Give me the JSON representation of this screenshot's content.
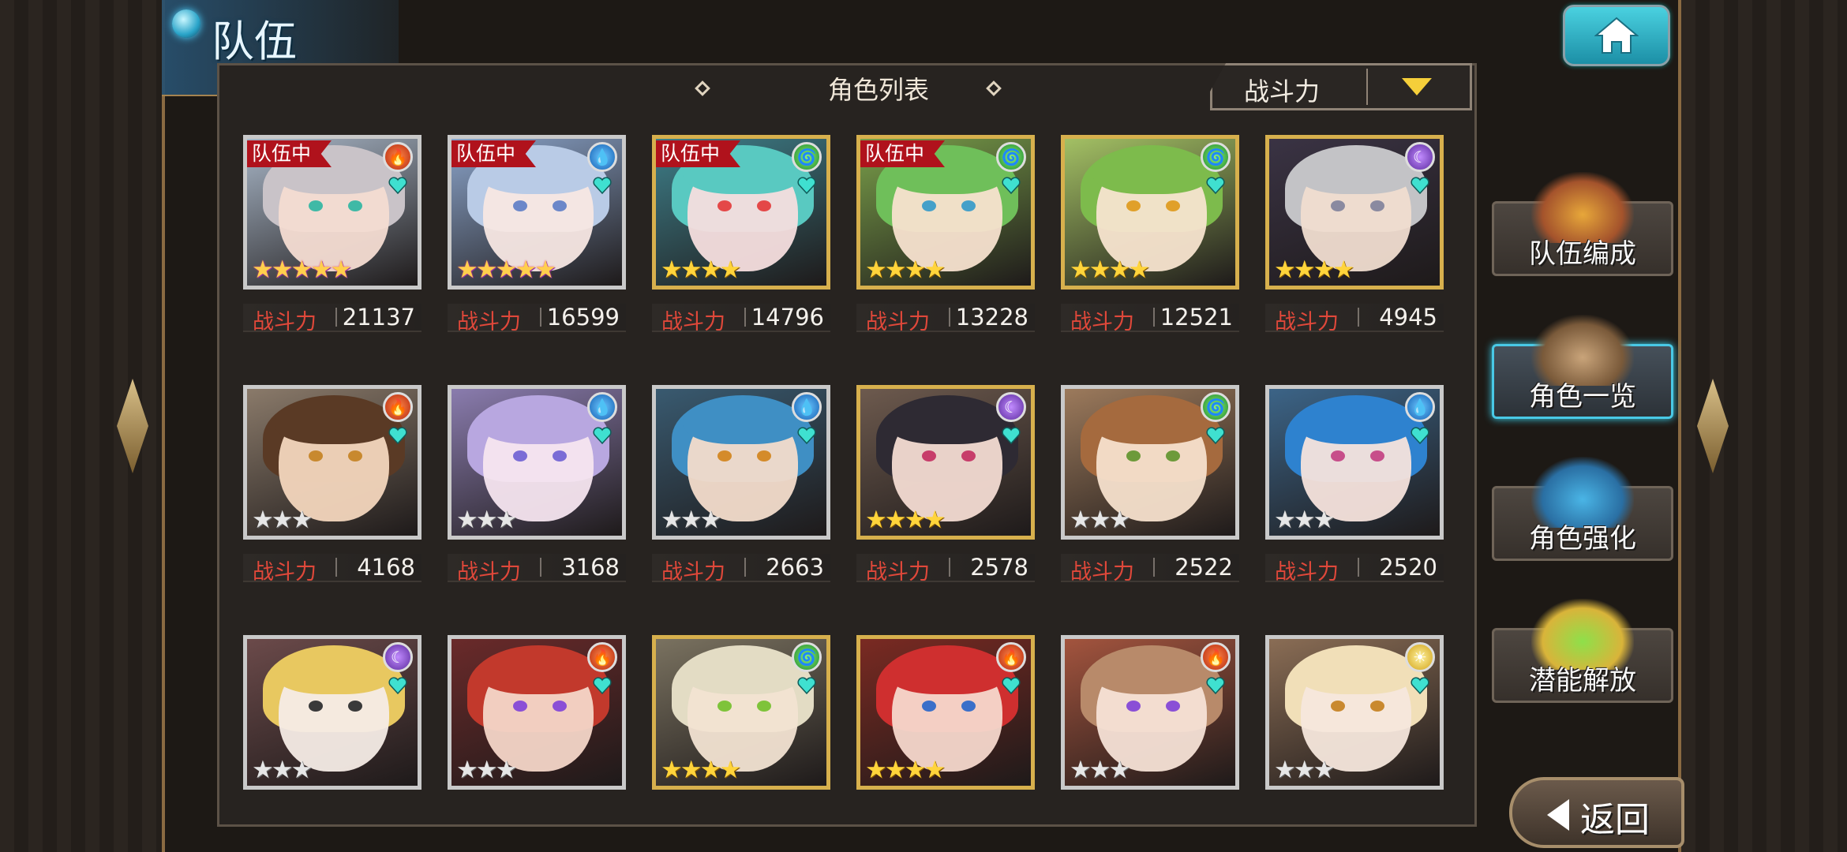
{
  "header": {
    "title": "队伍"
  },
  "panel": {
    "title": "角色列表",
    "sort": {
      "selected": "战斗力"
    }
  },
  "power_label": "战斗力",
  "team_badge_label": "队伍中",
  "characters": [
    {
      "in_team": true,
      "element": "fire",
      "rarity": 5,
      "frame": "silver",
      "power": "21137",
      "hair": "#c9c3c8",
      "skin": "#f4dcd2",
      "eyes": "#3fb9a6",
      "bg": "#a8b6c7"
    },
    {
      "in_team": true,
      "element": "water",
      "rarity": 5,
      "frame": "silver",
      "power": "16599",
      "hair": "#b9cbe6",
      "skin": "#f7e7e3",
      "eyes": "#6b87c9",
      "bg": "#8aa3c9"
    },
    {
      "in_team": true,
      "element": "wind",
      "rarity": 4,
      "frame": "gold",
      "power": "14796",
      "hair": "#59c9c1",
      "skin": "#f5dede",
      "eyes": "#e44848",
      "bg": "#3e7f8a"
    },
    {
      "in_team": true,
      "element": "wind",
      "rarity": 4,
      "frame": "gold",
      "power": "13228",
      "hair": "#6fbf5a",
      "skin": "#f7e1cf",
      "eyes": "#45a0c9",
      "bg": "#7a9f4a"
    },
    {
      "in_team": false,
      "element": "wind",
      "rarity": 4,
      "frame": "gold",
      "power": "12521",
      "hair": "#7dbb4c",
      "skin": "#f7e4cf",
      "eyes": "#e0a02a",
      "bg": "#a3c064"
    },
    {
      "in_team": false,
      "element": "dark",
      "rarity": 4,
      "frame": "gold",
      "power": "4945",
      "hair": "#c3c3c6",
      "skin": "#f0ddd0",
      "eyes": "#8a8aa0",
      "bg": "#3a3344"
    },
    {
      "in_team": false,
      "element": "fire",
      "rarity": 3,
      "frame": "silver",
      "power": "4168",
      "hair": "#5a3a25",
      "skin": "#f3d6bd",
      "eyes": "#c8892f",
      "bg": "#8a7a6a"
    },
    {
      "in_team": false,
      "element": "water",
      "rarity": 3,
      "frame": "silver",
      "power": "3168",
      "hair": "#b8a7e0",
      "skin": "#f5e5ef",
      "eyes": "#7a6cd6",
      "bg": "#8a7cae"
    },
    {
      "in_team": false,
      "element": "water",
      "rarity": 3,
      "frame": "silver",
      "power": "2663",
      "hair": "#3f8fc4",
      "skin": "#f3dccb",
      "eyes": "#d48b2a",
      "bg": "#395a70"
    },
    {
      "in_team": false,
      "element": "dark",
      "rarity": 4,
      "frame": "gold",
      "power": "2578",
      "hair": "#2e2a33",
      "skin": "#f3dbd2",
      "eyes": "#c73d6a",
      "bg": "#6d5a4e"
    },
    {
      "in_team": false,
      "element": "wind",
      "rarity": 3,
      "frame": "silver",
      "power": "2522",
      "hair": "#a56a3e",
      "skin": "#f6e0cc",
      "eyes": "#6d9a3a",
      "bg": "#9c7a5c"
    },
    {
      "in_team": false,
      "element": "water",
      "rarity": 3,
      "frame": "silver",
      "power": "2520",
      "hair": "#2e82cf",
      "skin": "#f6e3dc",
      "eyes": "#c74e8a",
      "bg": "#3c6487"
    },
    {
      "in_team": false,
      "element": "dark",
      "rarity": 3,
      "frame": "silver",
      "power": "",
      "hair": "#e8c860",
      "skin": "#f6ece6",
      "eyes": "#3a3a3a",
      "bg": "#6b4a4a"
    },
    {
      "in_team": false,
      "element": "fire",
      "rarity": 3,
      "frame": "silver",
      "power": "",
      "hair": "#c2392c",
      "skin": "#f4d6c8",
      "eyes": "#8a4fd6",
      "bg": "#6a2a2a"
    },
    {
      "in_team": false,
      "element": "wind",
      "rarity": 4,
      "frame": "gold",
      "power": "",
      "hair": "#e3dcc4",
      "skin": "#f2e3d2",
      "eyes": "#7ec33a",
      "bg": "#7a7260"
    },
    {
      "in_team": false,
      "element": "fire",
      "rarity": 4,
      "frame": "gold",
      "power": "",
      "hair": "#cf2f2f",
      "skin": "#f5d8cc",
      "eyes": "#3a6fc9",
      "bg": "#7a2a22"
    },
    {
      "in_team": false,
      "element": "fire",
      "rarity": 3,
      "frame": "silver",
      "power": "",
      "hair": "#b88a6a",
      "skin": "#f6e1d6",
      "eyes": "#8a4fd6",
      "bg": "#a3543e"
    },
    {
      "in_team": false,
      "element": "light",
      "rarity": 3,
      "frame": "silver",
      "power": "",
      "hair": "#f1dfb8",
      "skin": "#f6e7dc",
      "eyes": "#c9892f",
      "bg": "#8a6d55"
    }
  ],
  "menu": [
    {
      "id": "team-edit",
      "label": "队伍编成",
      "active": false
    },
    {
      "id": "character-list",
      "label": "角色一览",
      "active": true
    },
    {
      "id": "character-enhance",
      "label": "角色强化",
      "active": false
    },
    {
      "id": "potential-unlock",
      "label": "潜能解放",
      "active": false
    }
  ],
  "back": {
    "label": "返回"
  },
  "colors": {
    "accent": "#49c9e6",
    "power_label": "#e0483a",
    "team_badge": "#b0121c"
  }
}
